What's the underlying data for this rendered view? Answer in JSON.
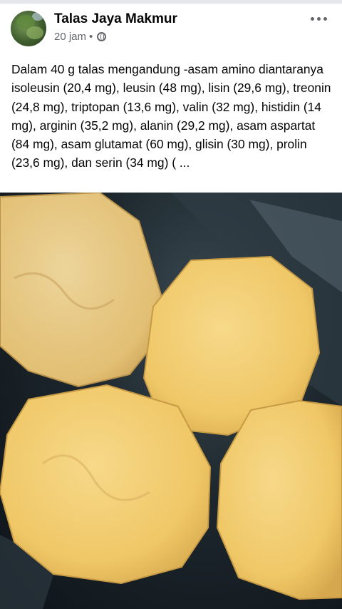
{
  "post": {
    "author": "Talas Jaya Makmur",
    "time": "20 jam",
    "separator": "•",
    "privacy_icon": "globe-icon",
    "more_icon": "more-dots-icon",
    "text": "Dalam 40 g talas mengandung -asam amino diantaranya isoleusin (20,4 mg), leusin (48 mg), lisin (29,6 mg), treonin (24,8 mg), triptopan (13,6 mg), valin (32 mg), histidin (14 mg), arginin (35,2 mg), alanin (29,2 mg), asam aspartat (84 mg), asam glutamat (60 mg), glisin (30 mg), prolin (23,6 mg), dan serin (34 mg) ( ..."
  },
  "photo": {
    "subject": "sliced taro pieces",
    "colors": {
      "taro": "#f2cc6a",
      "taro_shadow": "#d8a94a",
      "background": "#1c262c"
    }
  }
}
